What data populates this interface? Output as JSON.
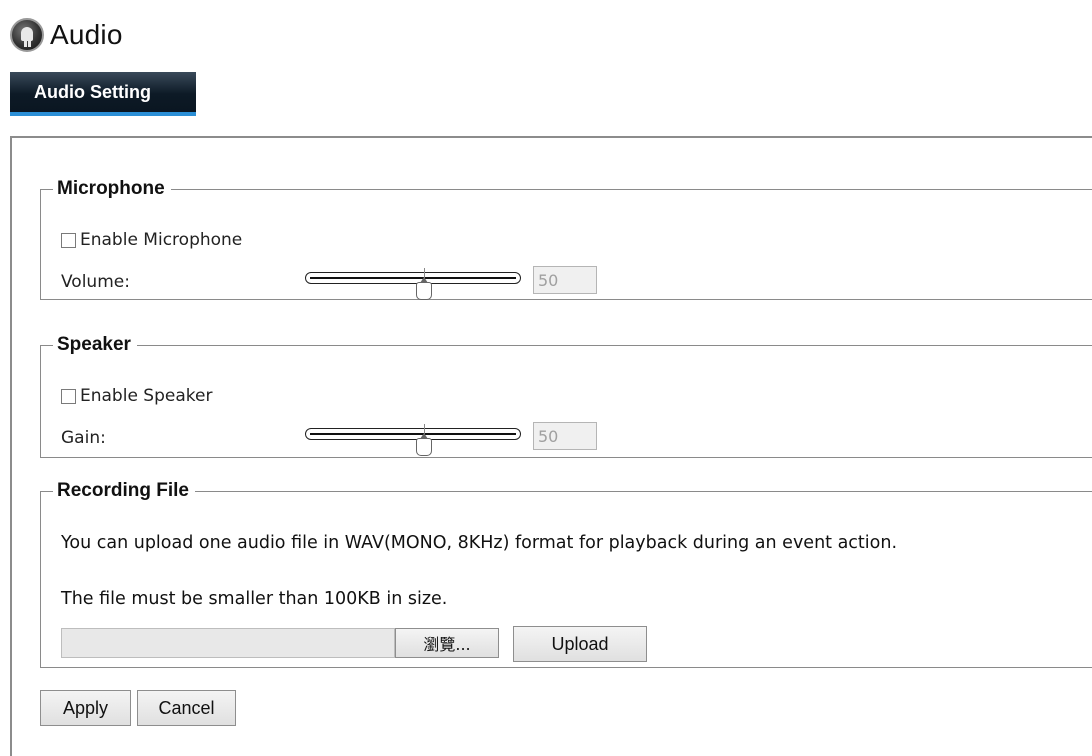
{
  "header": {
    "title": "Audio",
    "icon": "camera-logo-icon"
  },
  "tab": {
    "label": "Audio Setting",
    "active_color": "#2b8fd6"
  },
  "microphone": {
    "legend": "Microphone",
    "enable_label": "Enable Microphone",
    "enabled": false,
    "volume_label": "Volume:",
    "volume_value": "50",
    "volume_level": 50
  },
  "speaker": {
    "legend": "Speaker",
    "enable_label": "Enable Speaker",
    "enabled": false,
    "gain_label": "Gain:",
    "gain_value": "50",
    "gain_level": 50
  },
  "recording": {
    "legend": "Recording File",
    "line1": "You can upload one audio file in WAV(MONO, 8KHz) format for playback during an event action.",
    "line2": "The file must be smaller than 100KB in size.",
    "file_value": "",
    "browse_label": "瀏覽...",
    "upload_label": "Upload"
  },
  "actions": {
    "apply_label": "Apply",
    "cancel_label": "Cancel"
  }
}
